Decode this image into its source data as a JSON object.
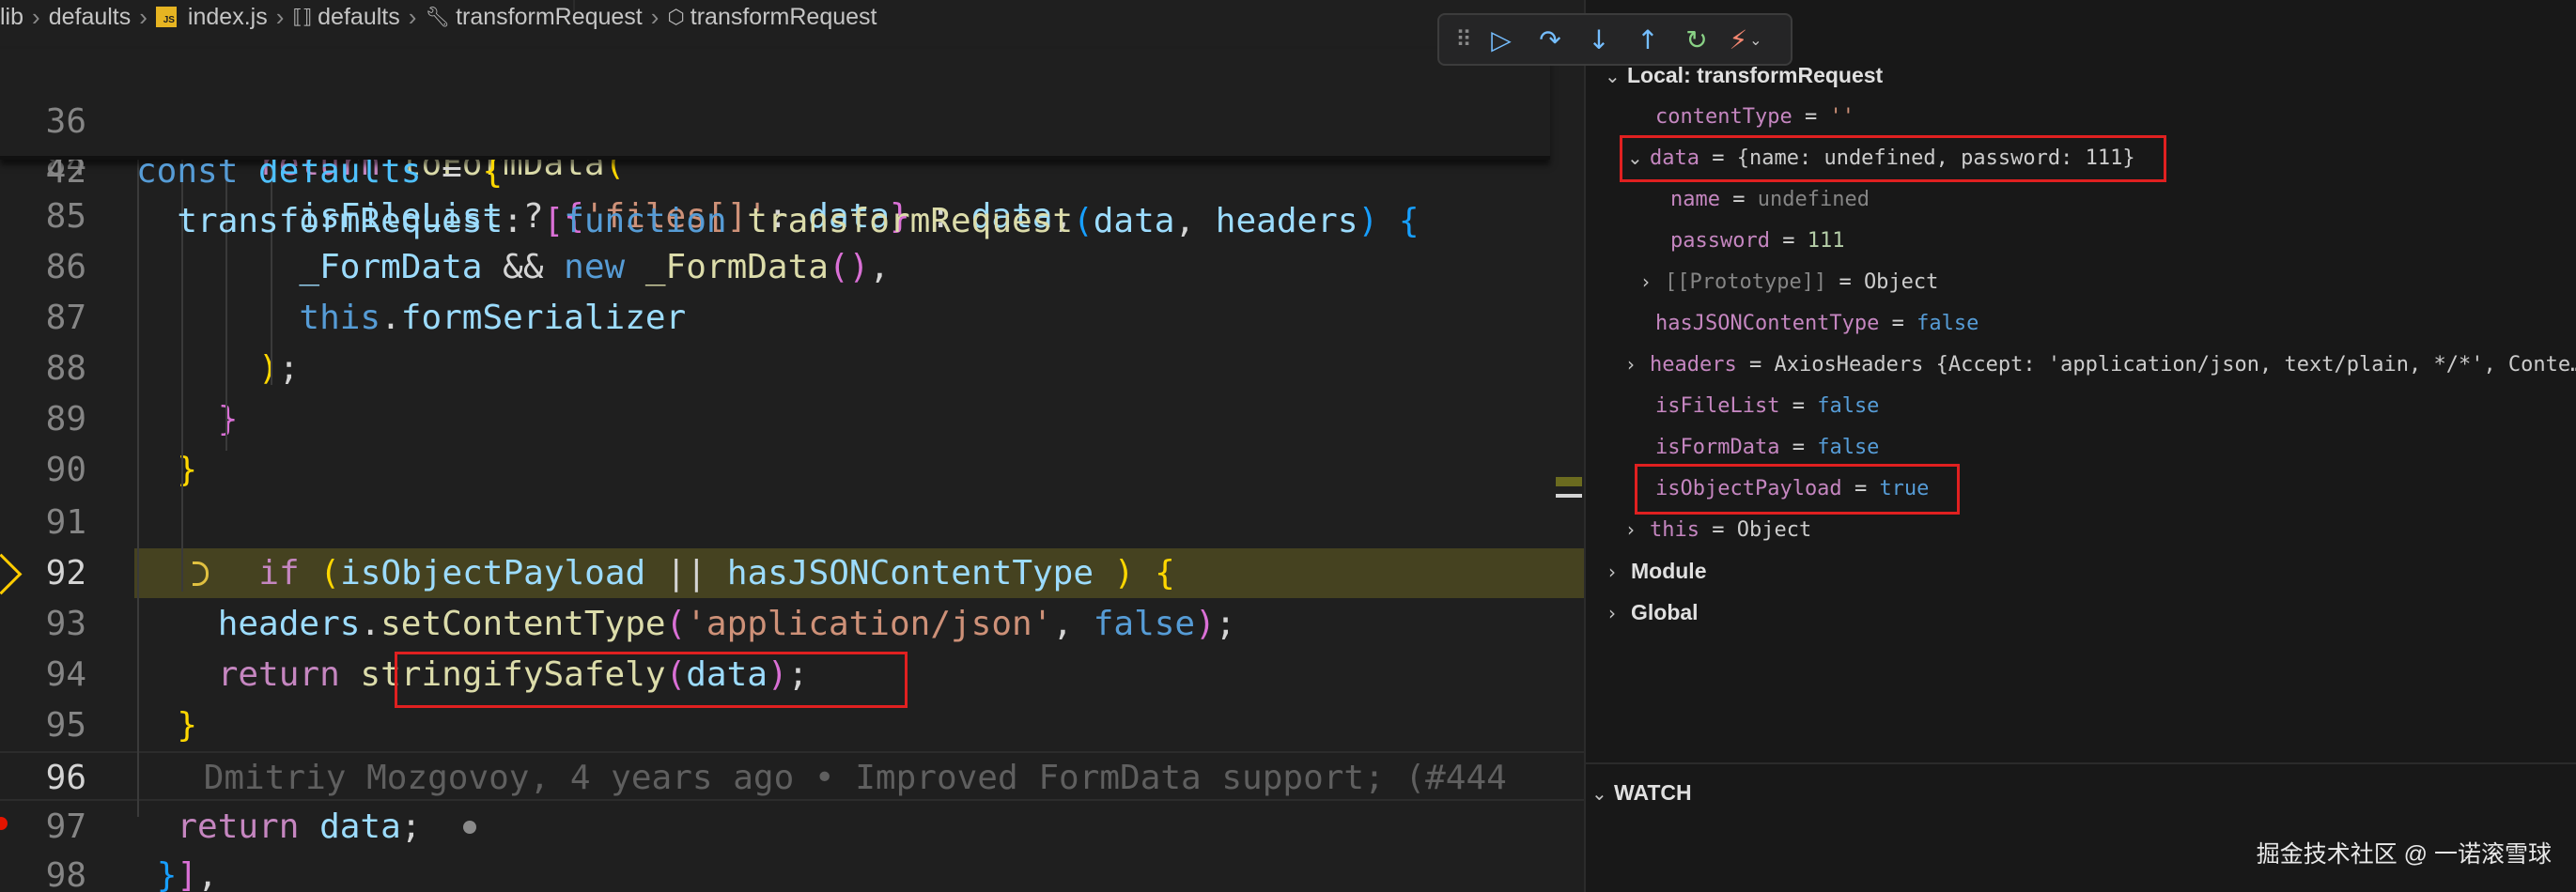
{
  "breadcrumb": {
    "items": [
      {
        "label": "lib",
        "icon": ""
      },
      {
        "label": "defaults",
        "icon": ""
      },
      {
        "label": "index.js",
        "icon": "js-file-icon",
        "badge": "JS"
      },
      {
        "label": "defaults",
        "icon": "variable-icon"
      },
      {
        "label": "transformRequest",
        "icon": "wrench-icon"
      },
      {
        "label": "transformRequest",
        "icon": "cube-icon"
      }
    ]
  },
  "editor": {
    "sticky_lines": [
      {
        "num": "36",
        "tokens": [
          [
            "kw",
            "const "
          ],
          [
            "const",
            "defaults"
          ],
          [
            "p",
            " = "
          ],
          [
            "b1",
            "{"
          ]
        ]
      },
      {
        "num": "42",
        "tokens": [
          [
            "p",
            "  "
          ],
          [
            "var",
            "transformRequest"
          ],
          [
            "p",
            ": "
          ],
          [
            "b2",
            "["
          ],
          [
            "kw",
            "function "
          ],
          [
            "fn",
            "transformRequest"
          ],
          [
            "b3",
            "("
          ],
          [
            "var",
            "data"
          ],
          [
            "p",
            ", "
          ],
          [
            "var",
            "headers"
          ],
          [
            "b3",
            ")"
          ],
          [
            "p",
            " "
          ],
          [
            "b3",
            "{"
          ]
        ]
      }
    ],
    "lines": [
      {
        "num": "84",
        "tokens": [
          [
            "p",
            "      "
          ],
          [
            "kw2",
            "return "
          ],
          [
            "fn",
            "toFormData"
          ],
          [
            "b1",
            "("
          ]
        ]
      },
      {
        "num": "85",
        "tokens": [
          [
            "p",
            "        "
          ],
          [
            "var",
            "isFileList"
          ],
          [
            "p",
            " ? "
          ],
          [
            "b2",
            "{"
          ],
          [
            "str",
            "'files[]'"
          ],
          [
            "p",
            ": "
          ],
          [
            "var",
            "data"
          ],
          [
            "b2",
            "}"
          ],
          [
            "p",
            " : "
          ],
          [
            "var",
            "data"
          ],
          [
            "p",
            ","
          ]
        ]
      },
      {
        "num": "86",
        "tokens": [
          [
            "p",
            "        "
          ],
          [
            "var",
            "_FormData"
          ],
          [
            "p",
            " && "
          ],
          [
            "kw",
            "new "
          ],
          [
            "fn",
            "_FormData"
          ],
          [
            "b2",
            "()"
          ],
          [
            "p",
            ","
          ]
        ]
      },
      {
        "num": "87",
        "tokens": [
          [
            "p",
            "        "
          ],
          [
            "kw",
            "this"
          ],
          [
            "p",
            "."
          ],
          [
            "var",
            "formSerializer"
          ]
        ]
      },
      {
        "num": "88",
        "tokens": [
          [
            "p",
            "      "
          ],
          [
            "b1",
            ")"
          ],
          [
            "p",
            ";"
          ]
        ]
      },
      {
        "num": "89",
        "tokens": [
          [
            "p",
            "    "
          ],
          [
            "b2",
            "}"
          ]
        ]
      },
      {
        "num": "90",
        "tokens": [
          [
            "p",
            "  "
          ],
          [
            "b1",
            "}"
          ]
        ]
      },
      {
        "num": "91",
        "tokens": []
      },
      {
        "num": "92",
        "tokens": [
          [
            "p",
            "  "
          ],
          [
            "kw2",
            "if "
          ],
          [
            "b1",
            "("
          ],
          [
            "var",
            "isObjectPayload"
          ],
          [
            "p",
            " || "
          ],
          [
            "var",
            "hasJSONContentType"
          ],
          [
            "p",
            " "
          ],
          [
            "b1",
            ")"
          ],
          [
            "p",
            " "
          ],
          [
            "b1",
            "{"
          ]
        ]
      },
      {
        "num": "93",
        "tokens": [
          [
            "p",
            "    "
          ],
          [
            "var",
            "headers"
          ],
          [
            "p",
            "."
          ],
          [
            "fn",
            "setContentType"
          ],
          [
            "b2",
            "("
          ],
          [
            "str",
            "'application/json'"
          ],
          [
            "p",
            ", "
          ],
          [
            "kw",
            "false"
          ],
          [
            "b2",
            ")"
          ],
          [
            "p",
            ";"
          ]
        ]
      },
      {
        "num": "94",
        "tokens": [
          [
            "p",
            "    "
          ],
          [
            "kw2",
            "return "
          ],
          [
            "fn",
            "stringifySafely"
          ],
          [
            "b2",
            "("
          ],
          [
            "var",
            "data"
          ],
          [
            "b2",
            ")"
          ],
          [
            "p",
            ";"
          ]
        ]
      },
      {
        "num": "95",
        "tokens": [
          [
            "p",
            "  "
          ],
          [
            "b1",
            "}"
          ]
        ]
      },
      {
        "num": "96",
        "tokens": [
          [
            "blame",
            "    Dmitriy Mozgovoy, 4 years ago • Improved FormData support; (#444"
          ]
        ]
      },
      {
        "num": "97",
        "tokens": [
          [
            "p",
            "  "
          ],
          [
            "kw2",
            "return "
          ],
          [
            "var",
            "data"
          ],
          [
            "p",
            ";"
          ]
        ]
      },
      {
        "num": "98",
        "tokens": [
          [
            "p",
            " "
          ],
          [
            "b3",
            "}"
          ],
          [
            "b2",
            "]"
          ],
          [
            "p",
            ","
          ]
        ]
      }
    ]
  },
  "debug_toolbar": {
    "buttons": [
      {
        "name": "drag-handle",
        "glyph": "⠿"
      },
      {
        "name": "continue",
        "glyph": "▷"
      },
      {
        "name": "step-over",
        "glyph": "↷"
      },
      {
        "name": "step-into",
        "glyph": "↓"
      },
      {
        "name": "step-out",
        "glyph": "↑"
      },
      {
        "name": "restart",
        "glyph": "↻"
      },
      {
        "name": "disconnect",
        "glyph": "⚡"
      }
    ]
  },
  "variables": {
    "local_scope": "Local: transformRequest",
    "content_type": {
      "name": "contentType",
      "value": "''"
    },
    "data": {
      "name": "data",
      "value": "{name: undefined, password: 111}"
    },
    "data_name": {
      "name": "name",
      "value": "undefined"
    },
    "data_password": {
      "name": "password",
      "value": "111"
    },
    "data_prototype": {
      "name": "[[Prototype]]",
      "value": "Object"
    },
    "has_json": {
      "name": "hasJSONContentType",
      "value": "false"
    },
    "headers": {
      "name": "headers",
      "value": "AxiosHeaders {Accept: 'application/json, text/plain, */*', Conte…"
    },
    "is_file_list": {
      "name": "isFileList",
      "value": "false"
    },
    "is_form_data": {
      "name": "isFormData",
      "value": "false"
    },
    "is_object_payload": {
      "name": "isObjectPayload",
      "value": "true"
    },
    "this_var": {
      "name": "this",
      "value": "Object"
    },
    "module_scope": "Module",
    "global_scope": "Global",
    "watch_title": "WATCH",
    "eq": "="
  },
  "watermark": "掘金技术社区 @ 一诺滚雪球"
}
